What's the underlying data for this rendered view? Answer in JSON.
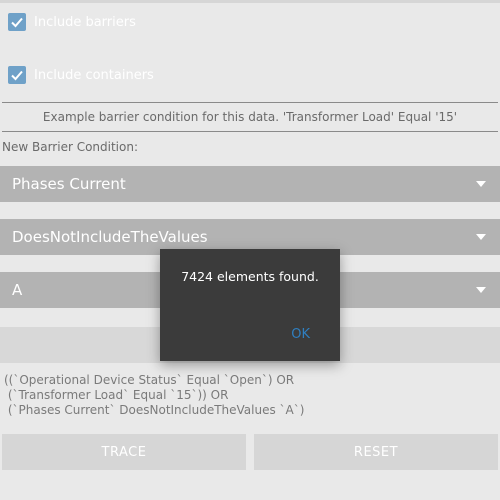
{
  "options": {
    "include_barriers": {
      "label": "Include barriers",
      "checked": true
    },
    "include_containers": {
      "label": "Include containers",
      "checked": true
    }
  },
  "example_text": "Example barrier condition for this data. 'Transformer Load' Equal '15'",
  "new_condition_label": "New Barrier Condition:",
  "selects": {
    "attribute": "Phases Current",
    "operator": "DoesNotIncludeTheValues",
    "value": "A"
  },
  "expression": {
    "lines": [
      "((`Operational Device Status` Equal `Open`) OR",
      " (`Transformer Load` Equal `15`)) OR",
      " (`Phases Current` DoesNotIncludeTheValues `A`)"
    ]
  },
  "buttons": {
    "trace": "TRACE",
    "reset": "RESET"
  },
  "dialog": {
    "message": "7424 elements found.",
    "ok": "OK"
  },
  "colors": {
    "accent": "#2f7fc0",
    "checkbox": "#6fa1c8",
    "dialog_bg": "#3b3b3b"
  }
}
